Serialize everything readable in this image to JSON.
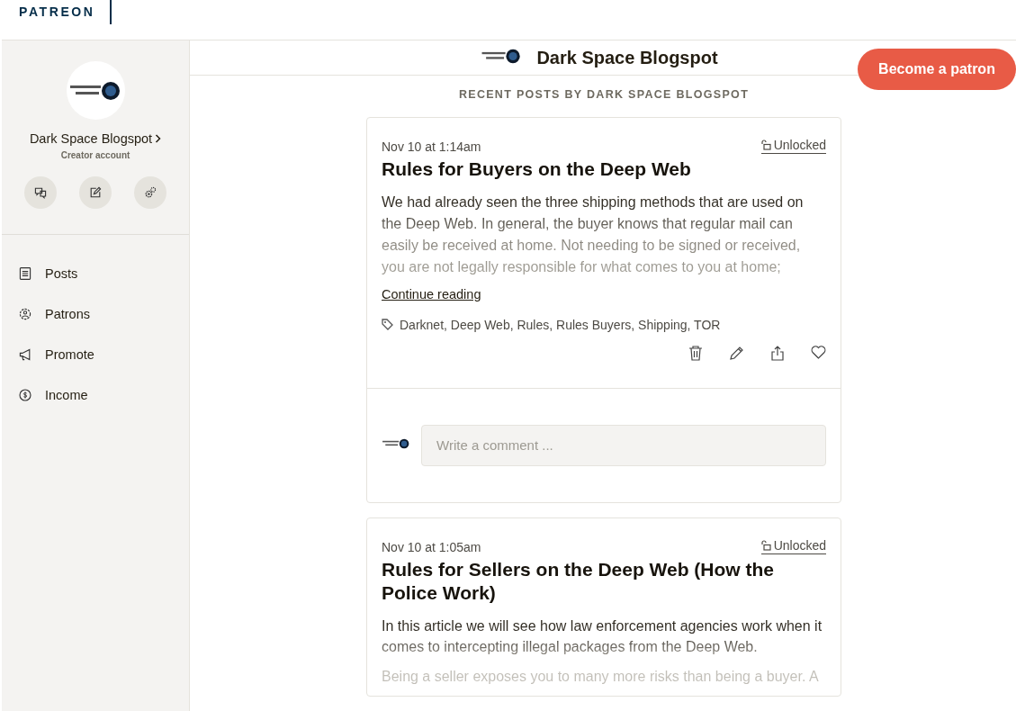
{
  "brand": "PATREON",
  "sidebar": {
    "creator_name": "Dark Space Blogspot",
    "account_type": "Creator account",
    "actions": [
      {
        "kind": "messages"
      },
      {
        "kind": "edit"
      },
      {
        "kind": "settings"
      }
    ],
    "nav": [
      {
        "kind": "posts",
        "label": "Posts"
      },
      {
        "kind": "patrons",
        "label": "Patrons"
      },
      {
        "kind": "promote",
        "label": "Promote"
      },
      {
        "kind": "income",
        "label": "Income"
      }
    ]
  },
  "header": {
    "title": "Dark Space Blogspot",
    "button": "Become a patron"
  },
  "feed_heading": "RECENT POSTS BY DARK SPACE BLOGSPOT",
  "posts": [
    {
      "date": "Nov 10 at 1:14am",
      "access": "Unlocked",
      "title": "Rules for Buyers on the Deep Web",
      "body": [
        "We had already seen the three shipping methods that are used on the Deep Web. In general, the buyer knows that regular mail can easily be received at home. Not needing to be signed or received, you are not legally responsible for what comes to you at home;"
      ],
      "continue": "Continue reading",
      "tags": "Darknet, Deep Web, Rules, Rules Buyers, Shipping, TOR",
      "comment_placeholder": "Write a comment ..."
    },
    {
      "date": "Nov 10 at 1:05am",
      "access": "Unlocked",
      "title": "Rules for Sellers on the Deep Web (How the Police Work)",
      "body": [
        "In this article we will see how law enforcement agencies work when it comes to intercepting illegal packages from the Deep Web.",
        "Being a seller exposes you to many more risks than being a buyer. A"
      ]
    }
  ]
}
